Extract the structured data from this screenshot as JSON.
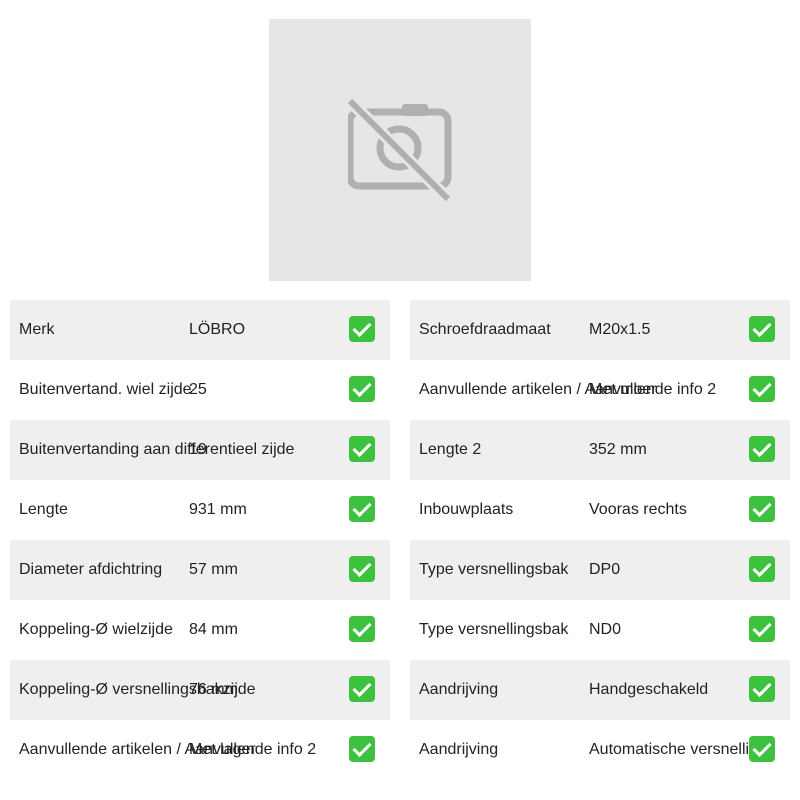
{
  "image": {
    "icon": "camera-off-icon"
  },
  "colors": {
    "check": "#3ec13e",
    "row_alt": "#efefef",
    "placeholder": "#e6e6e6"
  },
  "left_specs": [
    {
      "label": "Merk",
      "value": "LÖBRO"
    },
    {
      "label": "Buitenvertand. wiel zijde",
      "value": "25"
    },
    {
      "label": "Buitenvertanding aan differentieel zijde",
      "value": "19"
    },
    {
      "label": "Lengte",
      "value": "931 mm"
    },
    {
      "label": "Diameter afdichtring",
      "value": "57 mm"
    },
    {
      "label": "Koppeling-Ø wielzijde",
      "value": "84 mm"
    },
    {
      "label": "Koppeling-Ø versnellingsbakzijde",
      "value": "76 mm"
    },
    {
      "label": "Aanvullende artikelen / Aanvullende info 2",
      "value": "Met lager"
    }
  ],
  "right_specs": [
    {
      "label": "Schroefdraadmaat",
      "value": "M20x1.5"
    },
    {
      "label": "Aanvullende artikelen / Aanvullende info 2",
      "value": "Met moer"
    },
    {
      "label": "Lengte 2",
      "value": "352 mm"
    },
    {
      "label": "Inbouwplaats",
      "value": "Vooras rechts"
    },
    {
      "label": "Type versnellingsbak",
      "value": "DP0"
    },
    {
      "label": "Type versnellingsbak",
      "value": "ND0"
    },
    {
      "label": "Aandrijving",
      "value": "Handgeschakeld"
    },
    {
      "label": "Aandrijving",
      "value": "Automatische versnellings"
    }
  ]
}
